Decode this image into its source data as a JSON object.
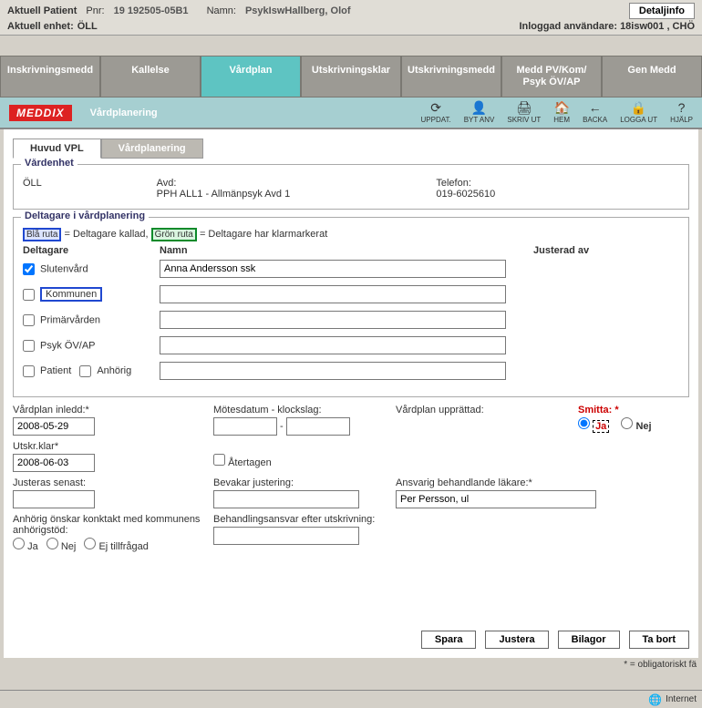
{
  "header": {
    "aktuell_patient": "Aktuell Patient",
    "pnr_lbl": "Pnr:",
    "pnr": "19 192505-05B1",
    "namn_lbl": "Namn:",
    "namn": "PsykIswHallberg, Olof",
    "detaljinfo": "Detaljinfo",
    "aktuell_enhet_lbl": "Aktuell enhet:",
    "aktuell_enhet": "ÖLL",
    "inloggad": "Inloggad användare: 18isw001 , CHÖ"
  },
  "nav": [
    "Inskrivningsmedd",
    "Kallelse",
    "Vårdplan",
    "Utskrivningsklar",
    "Utskrivningsmedd",
    "Medd PV/Kom/ Psyk ÖV/AP",
    "Gen Medd"
  ],
  "toolbar": {
    "title": "Vårdplanering",
    "icons": [
      {
        "glyph": "⟳",
        "label": "UPPDAT."
      },
      {
        "glyph": "👤",
        "label": "BYT ANV"
      },
      {
        "glyph": "🖨",
        "label": "SKRIV UT"
      },
      {
        "glyph": "🏠",
        "label": "HEM"
      },
      {
        "glyph": "←",
        "label": "BACKA"
      },
      {
        "glyph": "🔒",
        "label": "LOGGA UT"
      },
      {
        "glyph": "?",
        "label": "HJÄLP"
      }
    ]
  },
  "subtabs": [
    "Huvud VPL",
    "Vårdplanering"
  ],
  "vardenhet": {
    "legend": "Vårdenhet",
    "enhet": "ÖLL",
    "avd_lbl": "Avd:",
    "avd": "PPH ALL1 - Allmänpsyk Avd 1",
    "tel_lbl": "Telefon:",
    "tel": "019-6025610"
  },
  "deltagare": {
    "legend": "Deltagare i vårdplanering",
    "blue": "Blå ruta",
    "blue_txt": " = Deltagare kallad, ",
    "green": "Grön ruta",
    "green_txt": " = Deltagare har klarmarkerat",
    "col_deltagare": "Deltagare",
    "col_namn": "Namn",
    "col_justerad": "Justerad av",
    "rows": {
      "slutenvard": "Slutenvård",
      "slutenvard_name": "Anna Andersson ssk",
      "kommunen": "Kommunen",
      "primarvarden": "Primärvården",
      "psyk": "Psyk ÖV/AP",
      "patient": "Patient",
      "anhorig": "Anhörig"
    }
  },
  "form": {
    "inledd_lbl": "Vårdplan inledd:*",
    "inledd": "2008-05-29",
    "utskr_lbl": "Utskr.klar*",
    "utskr": "2008-06-03",
    "motes_lbl": "Mötesdatum - klockslag:",
    "upprat_lbl": "Vårdplan upprättad:",
    "smitta_lbl": "Smitta: *",
    "ja": "Ja",
    "nej": "Nej",
    "atertagen": "Återtagen",
    "justeras_lbl": "Justeras senast:",
    "bevakar_lbl": "Bevakar justering:",
    "ansvarig_lbl": "Ansvarig behandlande läkare:*",
    "ansvarig": "Per Persson, ul",
    "anhorig_kontakt_lbl": "Anhörig önskar konktakt med kommunens anhörigstöd:",
    "behand_lbl": "Behandlingsansvar efter utskrivning:",
    "ej_tillfragad": "Ej tillfrågad"
  },
  "footer": {
    "spara": "Spara",
    "justera": "Justera",
    "bilagor": "Bilagor",
    "tabort": "Ta bort",
    "oblig": "* = obligatoriskt fä"
  },
  "status": "Internet"
}
